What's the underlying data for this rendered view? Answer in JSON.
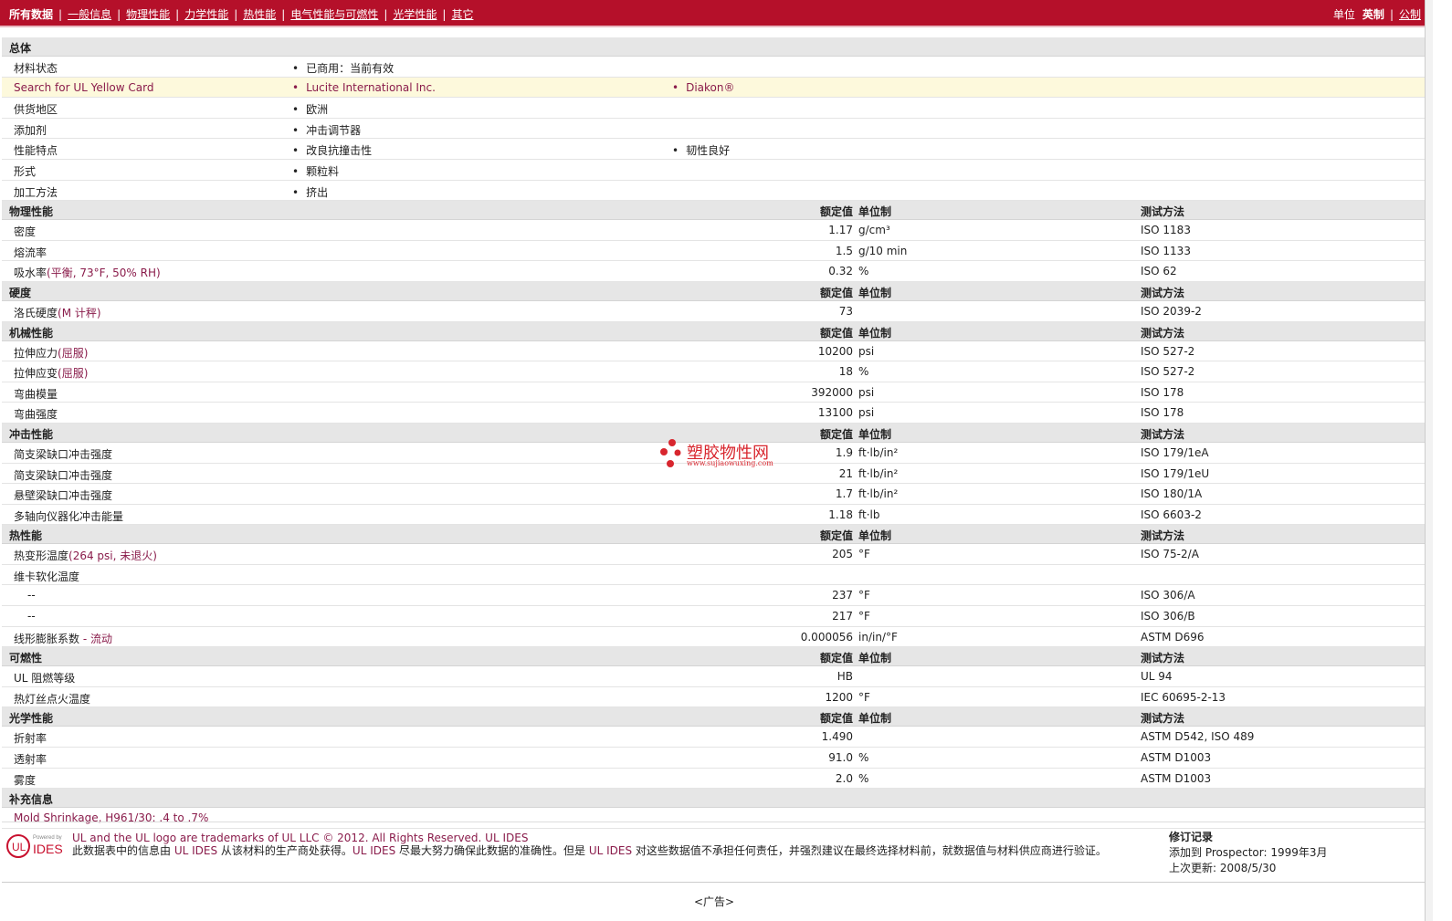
{
  "nav": {
    "tabs": [
      "所有数据",
      "一般信息",
      "物理性能",
      "力学性能",
      "热性能",
      "电气性能与可燃性",
      "光学性能",
      "其它"
    ],
    "units_label": "单位",
    "unit_current": "英制",
    "unit_other": "公制"
  },
  "general": {
    "title": "总体",
    "rows": [
      {
        "name": "材料状态",
        "values": [
          "已商用：当前有效"
        ]
      },
      {
        "name": "Search for UL Yellow Card",
        "values": [
          "Lucite International Inc.",
          "Diakon®"
        ]
      },
      {
        "name": "供货地区",
        "values": [
          "欧洲"
        ]
      },
      {
        "name": "添加剂",
        "values": [
          "冲击调节器"
        ]
      },
      {
        "name": "性能特点",
        "values": [
          "改良抗撞击性",
          "韧性良好"
        ]
      },
      {
        "name": "形式",
        "values": [
          "颗粒料"
        ]
      },
      {
        "name": "加工方法",
        "values": [
          "挤出"
        ]
      }
    ]
  },
  "headers": {
    "value": "额定值",
    "unit": "单位制",
    "method": "测试方法"
  },
  "sections": [
    {
      "title": "物理性能",
      "rows": [
        {
          "name": "密度",
          "note": "",
          "value": "1.17",
          "unit": "g/cm³",
          "method": "ISO 1183"
        },
        {
          "name": "熔流率",
          "note": "",
          "value": "1.5",
          "unit": "g/10 min",
          "method": "ISO 1133"
        },
        {
          "name": "吸水率",
          "note": "(平衡, 73°F, 50% RH)",
          "value": "0.32",
          "unit": "%",
          "method": "ISO 62"
        }
      ]
    },
    {
      "title": "硬度",
      "rows": [
        {
          "name": "洛氏硬度",
          "note": "(M 计秤)",
          "value": "73",
          "unit": "",
          "method": "ISO 2039-2"
        }
      ]
    },
    {
      "title": "机械性能",
      "rows": [
        {
          "name": "拉伸应力",
          "note": "(屈服)",
          "value": "10200",
          "unit": "psi",
          "method": "ISO 527-2"
        },
        {
          "name": "拉伸应变",
          "note": "(屈服)",
          "value": "18",
          "unit": "%",
          "method": "ISO 527-2"
        },
        {
          "name": "弯曲模量",
          "note": "",
          "value": "392000",
          "unit": "psi",
          "method": "ISO 178"
        },
        {
          "name": "弯曲强度",
          "note": "",
          "value": "13100",
          "unit": "psi",
          "method": "ISO 178"
        }
      ]
    },
    {
      "title": "冲击性能",
      "rows": [
        {
          "name": "简支梁缺口冲击强度",
          "note": "",
          "value": "1.9",
          "unit": "ft·lb/in²",
          "method": "ISO 179/1eA"
        },
        {
          "name": "简支梁缺口冲击强度",
          "note": "",
          "value": "21",
          "unit": "ft·lb/in²",
          "method": "ISO 179/1eU"
        },
        {
          "name": "悬壁梁缺口冲击强度",
          "note": "",
          "value": "1.7",
          "unit": "ft·lb/in²",
          "method": "ISO 180/1A"
        },
        {
          "name": "多轴向仪器化冲击能量",
          "note": "",
          "value": "1.18",
          "unit": "ft·lb",
          "method": "ISO 6603-2"
        }
      ]
    },
    {
      "title": "热性能",
      "rows": [
        {
          "name": "热变形温度",
          "note": "(264 psi, 未退火)",
          "value": "205",
          "unit": "°F",
          "method": "ISO 75-2/A"
        },
        {
          "name": "维卡软化温度",
          "note": "",
          "value": "",
          "unit": "",
          "method": ""
        },
        {
          "name": "--",
          "note": "",
          "value": "237",
          "unit": "°F",
          "method": "ISO 306/A",
          "indent": true
        },
        {
          "name": "--",
          "note": "",
          "value": "217",
          "unit": "°F",
          "method": "ISO 306/B",
          "indent": true
        },
        {
          "name": "线形膨胀系数",
          "note": " - 流动",
          "value": "0.000056",
          "unit": "in/in/°F",
          "method": "ASTM D696"
        }
      ]
    },
    {
      "title": "可燃性",
      "rows": [
        {
          "name": "UL 阻燃等级",
          "note": "",
          "value": "HB",
          "unit": "",
          "method": "UL 94"
        },
        {
          "name": "热灯丝点火温度",
          "note": "",
          "value": "1200",
          "unit": "°F",
          "method": "IEC 60695-2-13"
        }
      ]
    },
    {
      "title": "光学性能",
      "rows": [
        {
          "name": "折射率",
          "note": "",
          "value": "1.490",
          "unit": "",
          "method": "ASTM D542, ISO 489"
        },
        {
          "name": "透射率",
          "note": "",
          "value": "91.0",
          "unit": "%",
          "method": "ASTM D1003"
        },
        {
          "name": "雾度",
          "note": "",
          "value": "2.0",
          "unit": "%",
          "method": "ASTM D1003"
        }
      ]
    }
  ],
  "supplement": {
    "title": "补充信息",
    "text": "Mold Shrinkage, H961/30: .4 to .7%"
  },
  "watermark": {
    "title": "塑胶物性网",
    "url": "www.sujiaowuxing.com"
  },
  "footer": {
    "logo_powered": "Powered by",
    "logo_text": "IDES",
    "logo_ul": "UL",
    "legal1": "UL and the UL logo are trademarks of UL LLC © 2012. All Rights Reserved. UL IDES",
    "legal2_a": "此数据表中的信息由 ",
    "legal2_b": "UL IDES",
    "legal2_c": " 从该材料的生产商处获得。",
    "legal2_d": "UL IDES",
    "legal2_e": " 尽最大努力确保此数据的准确性。但是 ",
    "legal2_f": "UL IDES",
    "legal2_g": " 对这些数据值不承担任何责任，并强烈建议在最终选择材料前，就数据值与材料供应商进行验证。",
    "rev_title": "修订记录",
    "rev_added_label": "添加到 Prospector:",
    "rev_added_date": "1999年3月",
    "rev_updated_label": "上次更新:",
    "rev_updated_date": "2008/5/30"
  },
  "ad": "<广告>"
}
